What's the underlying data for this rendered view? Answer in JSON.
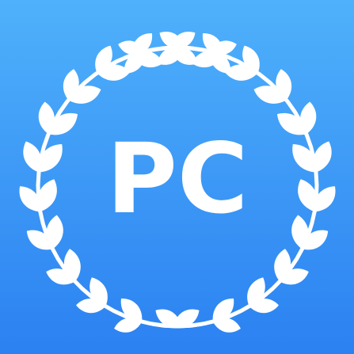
{
  "icon": {
    "name": "laurel-wreath-icon",
    "monogram": "PC",
    "colors": {
      "gradient_top": "#4fb1fb",
      "gradient_bottom": "#2b81f1",
      "foreground": "#ffffff"
    }
  }
}
